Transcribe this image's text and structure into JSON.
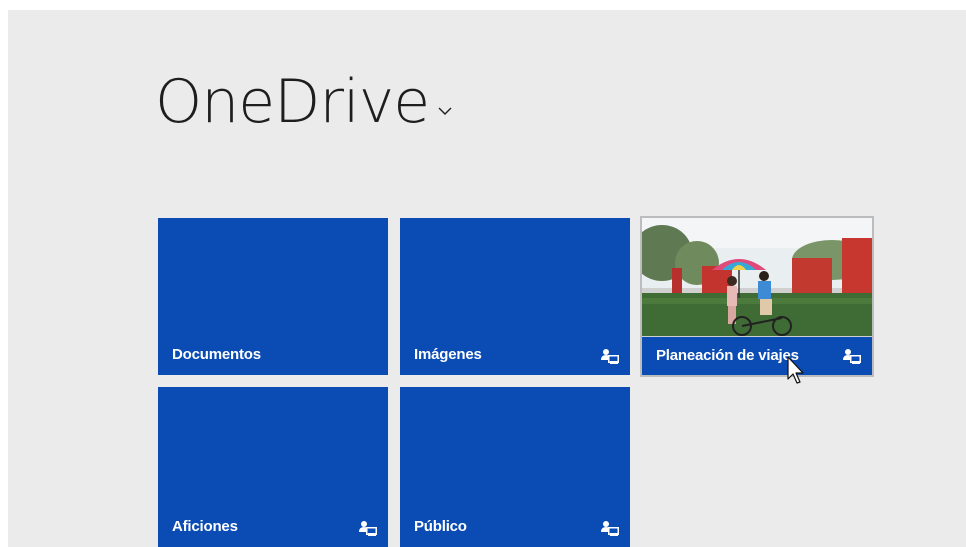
{
  "header": {
    "title": "OneDrive",
    "chevron_icon": "chevron-down-icon"
  },
  "tiles": [
    {
      "label": "Documentos",
      "shared": false
    },
    {
      "label": "Imágenes",
      "shared": true
    },
    {
      "label": "Planeación de viajes",
      "shared": true,
      "has_thumbnail": true
    },
    {
      "label": "Aficiones",
      "shared": true
    },
    {
      "label": "Público",
      "shared": true
    }
  ],
  "colors": {
    "tile_blue": "#0b4cb4",
    "background": "#ebebeb",
    "title_text": "#1e1e1e"
  },
  "icons": {
    "shared_folder": "shared-folder-icon",
    "cursor": "mouse-pointer-icon"
  }
}
